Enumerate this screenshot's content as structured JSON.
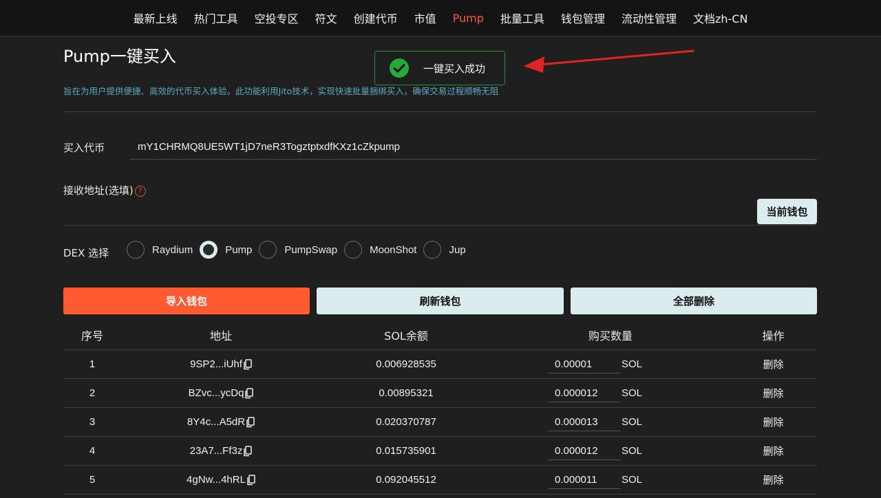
{
  "nav": {
    "items": [
      {
        "label": "最新上线"
      },
      {
        "label": "热门工具"
      },
      {
        "label": "空投专区"
      },
      {
        "label": "符文"
      },
      {
        "label": "创建代币"
      },
      {
        "label": "市值"
      },
      {
        "label": "Pump",
        "active": true
      },
      {
        "label": "批量工具"
      },
      {
        "label": "钱包管理"
      },
      {
        "label": "流动性管理"
      },
      {
        "label": "文档zh-CN"
      }
    ]
  },
  "page": {
    "title": "Pump一键买入",
    "subtitle": "旨在为用户提供便捷、高效的代币买入体验。此功能利用Jito技术，实现快速批量捆绑买入，确保交易过程顺畅无阻"
  },
  "toast": {
    "message": "一键买入成功",
    "icon": "check-circle-icon",
    "color": "#2f8a3a"
  },
  "form": {
    "token_label": "买入代币",
    "token_value": "mY1CHRMQ8UE5WT1jD7neR3TogztptxdfKXz1cZkpump",
    "receive_label": "接收地址(选填)",
    "receive_value": "",
    "current_wallet_button": "当前钱包",
    "dex_label": "DEX 选择",
    "dex_options": [
      {
        "label": "Raydium",
        "checked": false
      },
      {
        "label": "Pump",
        "checked": true
      },
      {
        "label": "PumpSwap",
        "checked": false
      },
      {
        "label": "MoonShot",
        "checked": false
      },
      {
        "label": "Jup",
        "checked": false
      }
    ]
  },
  "actions": {
    "import_wallet": "导入钱包",
    "refresh_wallet": "刷新钱包",
    "delete_all": "全部删除"
  },
  "table": {
    "headers": {
      "index": "序号",
      "address": "地址",
      "balance": "SOL余额",
      "amount": "购买数量",
      "ops": "操作"
    },
    "rows": [
      {
        "index": "1",
        "address": "9SP2...iUhf",
        "balance": "0.006928535",
        "amount": "0.00001",
        "unit": "SOL",
        "action": "删除"
      },
      {
        "index": "2",
        "address": "BZvc...ycDq",
        "balance": "0.00895321",
        "amount": "0.000012",
        "unit": "SOL",
        "action": "删除"
      },
      {
        "index": "3",
        "address": "8Y4c...A5dR",
        "balance": "0.020370787",
        "amount": "0.000013",
        "unit": "SOL",
        "action": "删除"
      },
      {
        "index": "4",
        "address": "23A7...Ff3z",
        "balance": "0.015735901",
        "amount": "0.000012",
        "unit": "SOL",
        "action": "删除"
      },
      {
        "index": "5",
        "address": "4gNw...4hRL",
        "balance": "0.092045512",
        "amount": "0.000011",
        "unit": "SOL",
        "action": "删除"
      }
    ]
  },
  "colors": {
    "accent": "#ff5a30",
    "light_button": "#dbecee",
    "subtitle": "#5ba9c0",
    "success": "#2f8a3a"
  }
}
